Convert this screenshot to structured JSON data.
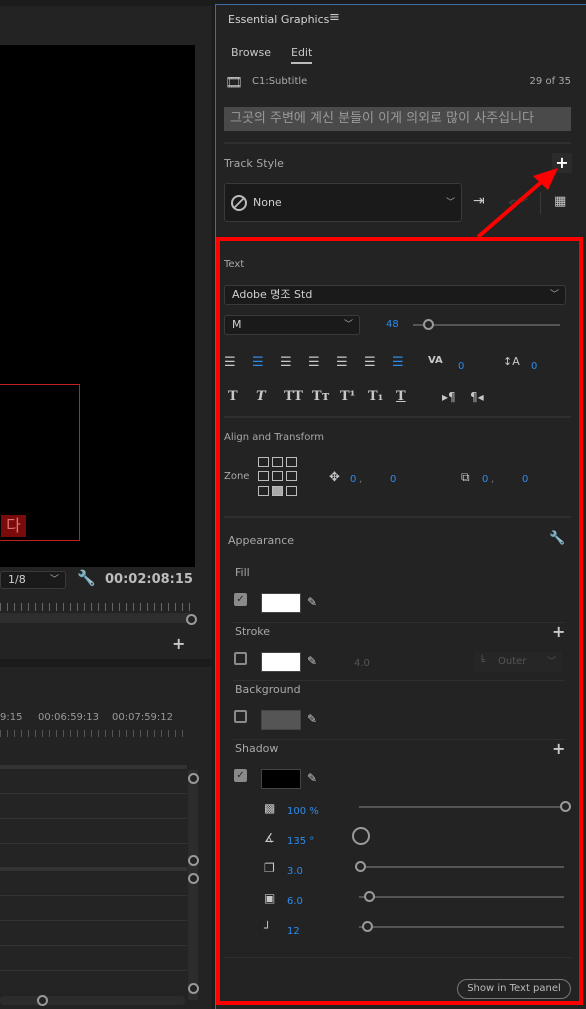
{
  "program_monitor": {
    "subtitle_char": "다",
    "resolution": "1/8",
    "timecode": "00:02:08:15"
  },
  "timeline": {
    "ruler_labels": [
      "9:15",
      "00:06:59:13",
      "00:07:59:12"
    ]
  },
  "essential_graphics": {
    "title": "Essential Graphics",
    "tabs": [
      {
        "label": "Browse",
        "active": false
      },
      {
        "label": "Edit",
        "active": true
      }
    ],
    "clip_name": "C1:Subtitle",
    "clip_counter": "29 of 35",
    "caption_text": "그곳의 주변에 계신 분들이 이게 의외로 많이 사주십니다",
    "track_style": {
      "label": "Track Style",
      "selected": "None"
    },
    "text_section": {
      "label": "Text",
      "font": "Adobe 명조 Std",
      "font_style": "M",
      "font_size": "48",
      "font_size_slider_fraction": 0.1,
      "tracking": "0",
      "leading": "0",
      "active_alignment": "center",
      "align_icons": [
        "align-left",
        "align-center",
        "align-right",
        "justify-left",
        "justify-all",
        "justify-center",
        "justify-bottom"
      ],
      "style_buttons": [
        "T",
        "T",
        "TT",
        "Tт",
        "T¹",
        "T₁",
        "T"
      ]
    },
    "align_transform": {
      "label": "Align and Transform",
      "zone_label": "Zone",
      "position_x": "0",
      "position_y": "0",
      "anchor_x": "0",
      "anchor_y": "0"
    },
    "appearance": {
      "label": "Appearance",
      "fill": {
        "label": "Fill",
        "checked": true,
        "color": "#ffffff"
      },
      "stroke": {
        "label": "Stroke",
        "checked": false,
        "color": "#ffffff",
        "width": "4.0",
        "position": "Outer"
      },
      "background": {
        "label": "Background",
        "checked": false,
        "color": "#555555"
      },
      "shadow": {
        "label": "Shadow",
        "checked": true,
        "color": "#000000",
        "opacity": "100 %",
        "angle": "135 °",
        "distance": "3.0",
        "size": "6.0",
        "blur": "12"
      }
    },
    "show_in_text_panel": "Show in Text panel"
  },
  "colors": {
    "accent": "#2d8ceb",
    "annotation": "#ff0000",
    "panel": "#232323"
  }
}
